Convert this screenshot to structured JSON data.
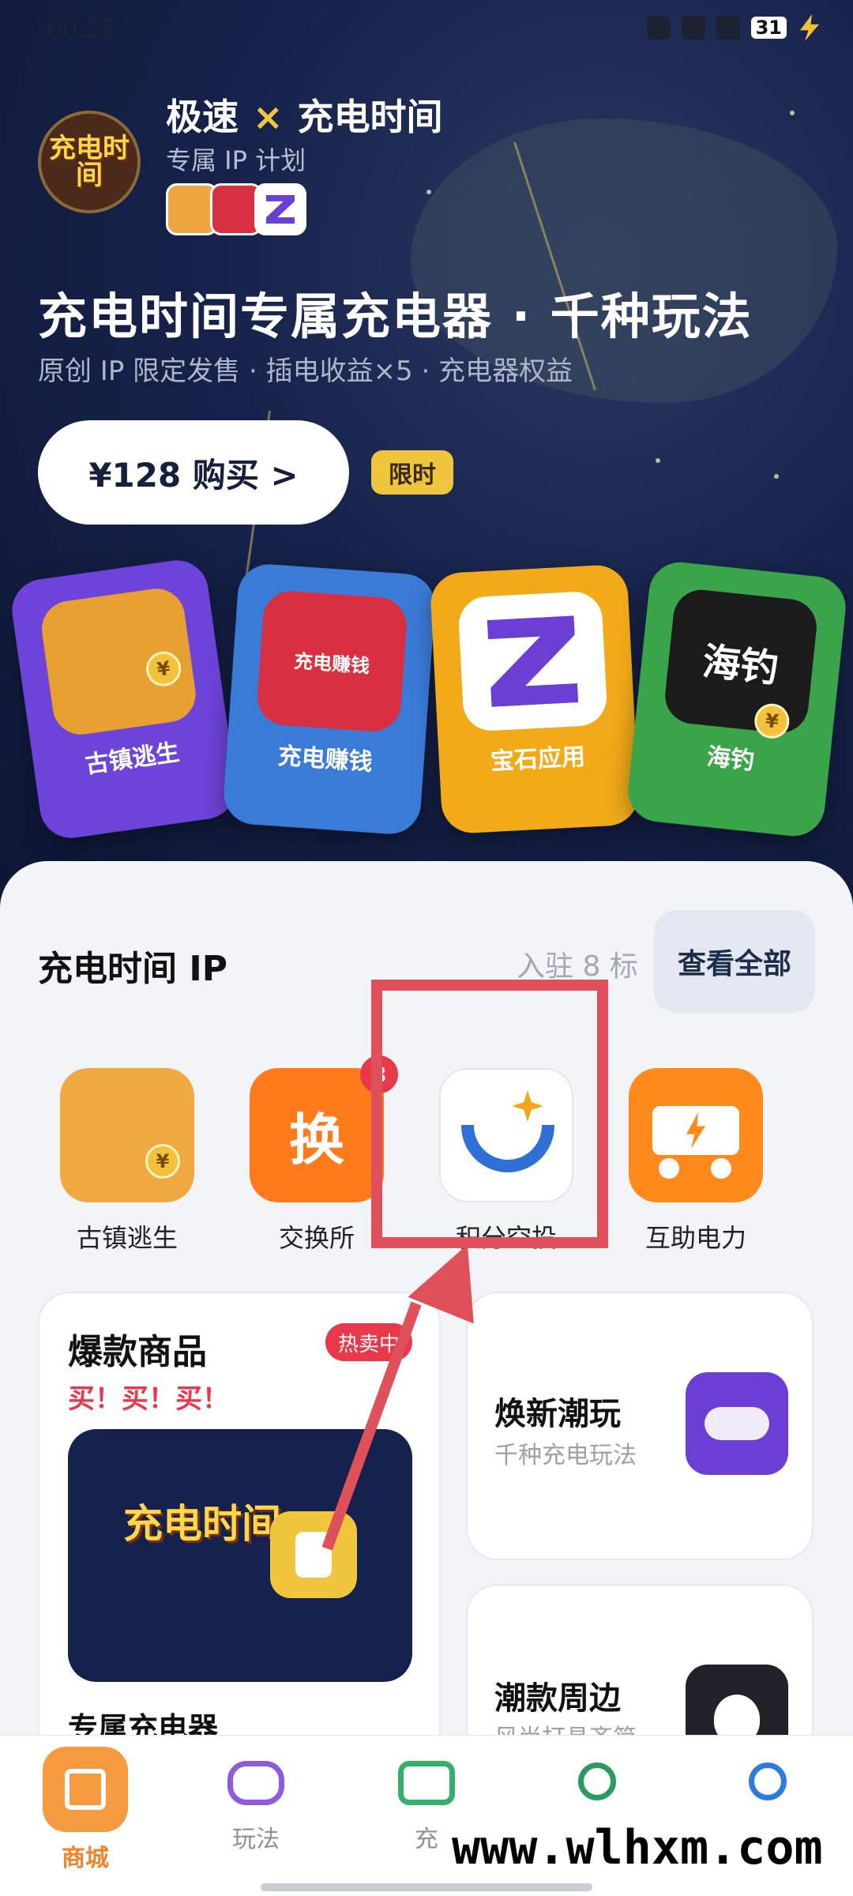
{
  "status_bar": {
    "time": "00:23",
    "battery": "31"
  },
  "hero": {
    "brand_left": "极速",
    "cross": "×",
    "brand_right": "充电时间",
    "subtitle": "专属 IP 计划",
    "logo_text": "充电时间",
    "title": "充电时间专属充电器 · 千种玩法",
    "features": "原创 IP 限定发售 · 插电收益×5 · 充电器权益",
    "buy_label": "¥128  购买  >",
    "limited_tag": "限时",
    "cards": [
      {
        "label": "古镇逃生",
        "color": "#6e43d9"
      },
      {
        "label": "充电赚钱",
        "inner_text": "充电赚钱",
        "color": "#3b7bd8"
      },
      {
        "label": "宝石应用",
        "color": "#f2aa18"
      },
      {
        "label": "海钓",
        "inner_text": "海钓",
        "color": "#3aa44a"
      }
    ],
    "coin_symbol": "¥"
  },
  "ip_section": {
    "title": "充电时间 IP",
    "count": "入驻 8 标",
    "view_all": "查看全部",
    "shortcuts": [
      {
        "name": "古镇逃生",
        "icon": "character-icon"
      },
      {
        "name": "交换所",
        "icon_text": "换",
        "badge": "3"
      },
      {
        "name": "积分空投",
        "icon": "smile-sparkle-icon"
      },
      {
        "name": "互助电力",
        "icon": "power-truck-icon"
      }
    ]
  },
  "hot_card": {
    "title": "爆款商品",
    "tag": "热卖中",
    "slogan": "买！买！买！",
    "image_logo": "充电时间",
    "product_name": "专属充电器"
  },
  "side_cards": [
    {
      "title": "焕新潮玩",
      "subtitle": "千种充电玩法"
    },
    {
      "title": "潮款周边",
      "subtitle": "风尚打具齐简"
    }
  ],
  "bottom_nav": [
    {
      "label": "商城",
      "active": true
    },
    {
      "label": "玩法"
    },
    {
      "label": "充"
    },
    {
      "label": ""
    },
    {
      "label": ""
    }
  ],
  "watermark": "www.wlhxm.com",
  "colors": {
    "accent": "#f0842a",
    "highlight": "#e0505a",
    "hero_bg": "#16224a"
  }
}
